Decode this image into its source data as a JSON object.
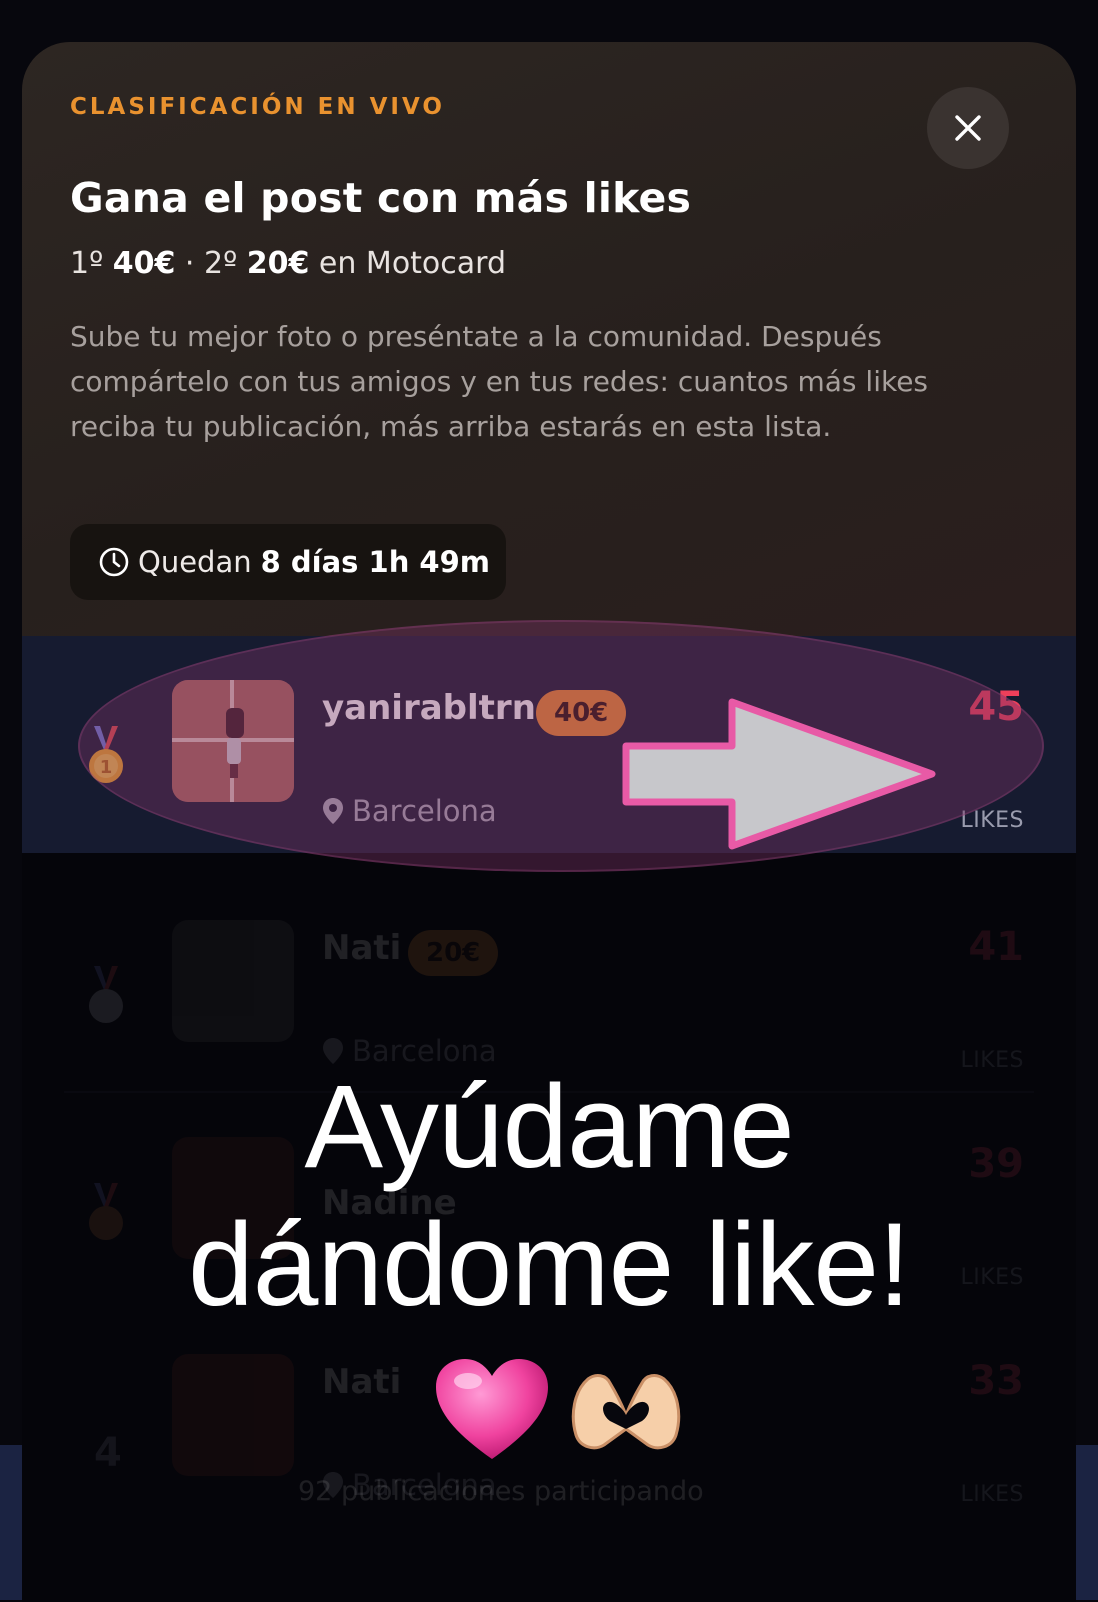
{
  "header": {
    "eyebrow": "CLASIFICACIÓN EN VIVO",
    "title": "Gana el post con más likes",
    "prize1_pre": "1º ",
    "prize1_amount": "40€",
    "prize_sep": " · 2º ",
    "prize2_amount": "20€",
    "prize_suffix": " en Motocard",
    "description": "Sube tu mejor foto o preséntate a la comunidad. Después compártelo con tus amigos y en tus redes: cuantos más likes reciba tu publicación, más arriba estarás en esta lista.",
    "timer_prefix": "Quedan",
    "timer_value": "8 días 1h 49m",
    "close_icon": "close-icon"
  },
  "leaderboard": {
    "entries": [
      {
        "rank": "1",
        "medal": "gold-medal",
        "username": "yanirabltrn",
        "prize": "40€",
        "location": "Barcelona",
        "likes": "45",
        "likes_label": "LIKES"
      },
      {
        "rank": "2",
        "medal": "silver-medal",
        "username": "Nati",
        "prize": "20€",
        "location": "Barcelona",
        "likes": "41",
        "likes_label": "LIKES"
      },
      {
        "rank": "3",
        "medal": "bronze-medal",
        "username": "Nadine",
        "location": "",
        "likes": "39",
        "likes_label": "LIKES"
      },
      {
        "rank": "4",
        "username": "Nati",
        "location": "Barcelona",
        "likes": "33",
        "likes_label": "LIKES"
      }
    ],
    "footer": "92 publicaciones participando"
  },
  "overlay": {
    "caption_line1": "Ayúdame",
    "caption_line2": "dándome like!",
    "emojis": [
      "pink-heart",
      "heart-hands"
    ]
  },
  "colors": {
    "accent_orange": "#e9922f",
    "likes_red": "#ee3f5a",
    "highlight_pink": "#e85aa6"
  }
}
